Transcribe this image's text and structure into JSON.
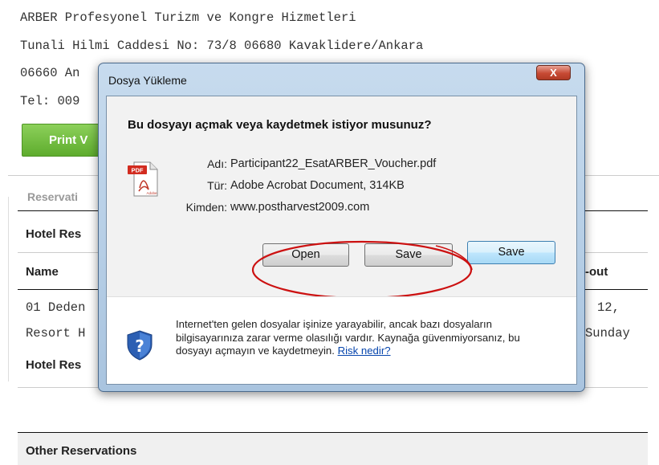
{
  "background": {
    "address_lines": [
      "ARBER Profesyonel Turizm ve Kongre Hizmetleri",
      "Tunali Hilmi Caddesi No: 73/8 06680 Kavaklidere/Ankara",
      "06660 An",
      "Tel: 009"
    ],
    "print_button_label": "Print V",
    "reservation_legend": "Reservati",
    "hotel_res_header_1": "Hotel Res",
    "name_column": "Name",
    "checkout_column": "-out",
    "row_1_col_1": "01 Deden",
    "row_1_col_2": "Resort H",
    "row_1_right_1": "12,",
    "row_1_right_2": "Sunday",
    "hotel_res_header_2": "Hotel Res",
    "other_reservations": "Other Reservations"
  },
  "dialog": {
    "title": "Dosya Yükleme",
    "close_label": "X",
    "question": "Bu dosyayı açmak veya kaydetmek istiyor musunuz?",
    "pdf_icon_text": "PDF",
    "pdf_icon_brand": "Adobe",
    "fields": [
      {
        "label": "Adı:",
        "value": "Participant22_EsatARBER_Voucher.pdf"
      },
      {
        "label": "Tür:",
        "value": "Adobe Acrobat Document, 314KB"
      },
      {
        "label": "Kimden:",
        "value": "www.postharvest2009.com"
      }
    ],
    "buttons": {
      "open": "Open",
      "save_1": "Save",
      "save_2": "Save"
    },
    "warning": {
      "text": "Internet'ten gelen dosyalar işinize yarayabilir, ancak bazı dosyaların bilgisayarınıza zarar verme olasılığı vardır. Kaynağa güvenmiyorsanız, bu dosyayı açmayın ve kaydetmeyin. ",
      "link": "Risk nedir?"
    },
    "highlight_color": "#cc1111"
  }
}
